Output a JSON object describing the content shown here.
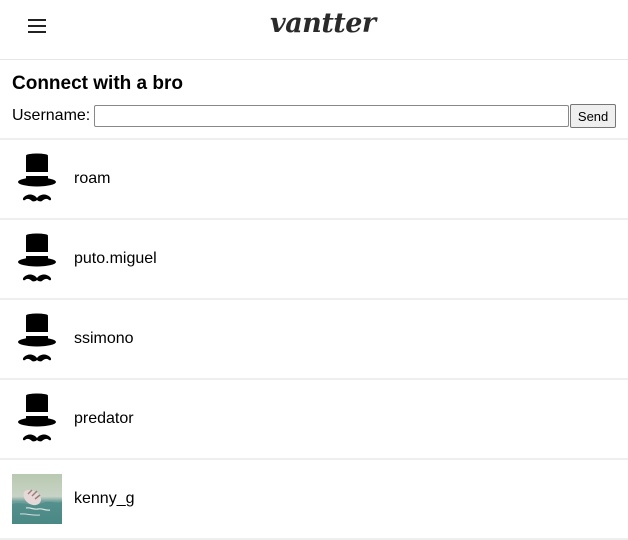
{
  "header": {
    "menu_icon": "hamburger-icon",
    "logo_text": "vantter"
  },
  "connect": {
    "title": "Connect with a bro",
    "username_label": "Username:",
    "username_value": "",
    "send_label": "Send"
  },
  "bros": [
    {
      "username": "roam",
      "avatar": "top-hat-mustache-icon"
    },
    {
      "username": "puto.miguel",
      "avatar": "top-hat-mustache-icon"
    },
    {
      "username": "ssimono",
      "avatar": "top-hat-mustache-icon"
    },
    {
      "username": "predator",
      "avatar": "top-hat-mustache-icon"
    },
    {
      "username": "kenny_g",
      "avatar": "photo-avatar"
    }
  ]
}
